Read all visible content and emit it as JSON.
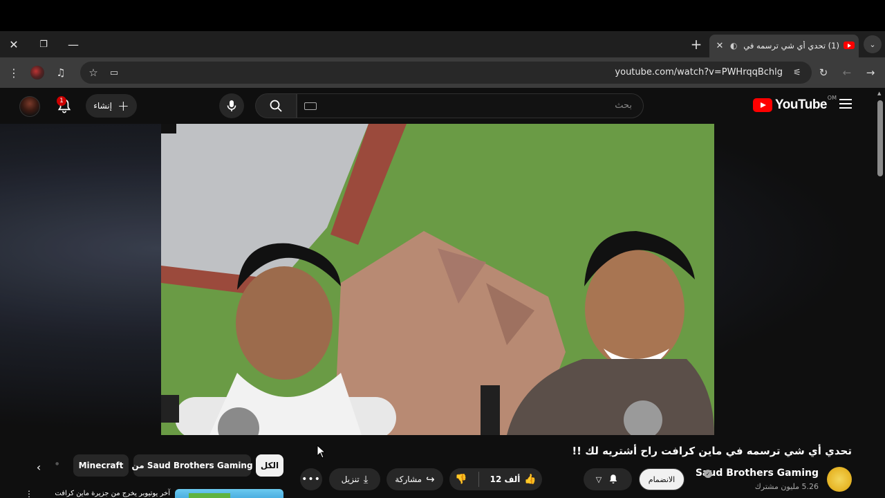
{
  "browser": {
    "tab_title": "(1) تحدي أي شي ترسمه في ما",
    "url": "youtube.com/watch?v=PWHrqqBchlg",
    "new_tab_icon": "plus-icon",
    "window_controls": [
      "close",
      "restore",
      "minimize"
    ]
  },
  "youtube": {
    "logo_text": "YouTube",
    "logo_country": "OM",
    "search_placeholder": "بحث",
    "create_label": "إنشاء",
    "notification_count": "1",
    "video_title": "تحدي أي شي ترسمه في ماين كرافت راح أشتريه لك !!",
    "channel_name": "Saud Brothers Gaming",
    "subscribers": "5.26 مليون مشترك",
    "join_label": "الانضمام",
    "likes": "12 ألف",
    "share_label": "مشاركة",
    "download_label": "تنزيل",
    "chips": [
      "الكل",
      "من Saud Brothers Gaming",
      "Minecraft"
    ],
    "recommended_title": "آخر يوتيوبر يخرج من جزيرة ماين كرافت"
  },
  "colors": {
    "brand_red": "#ff0000",
    "background": "#0f0f0f",
    "chip_bg": "#272727",
    "badge": "#cc0000"
  }
}
